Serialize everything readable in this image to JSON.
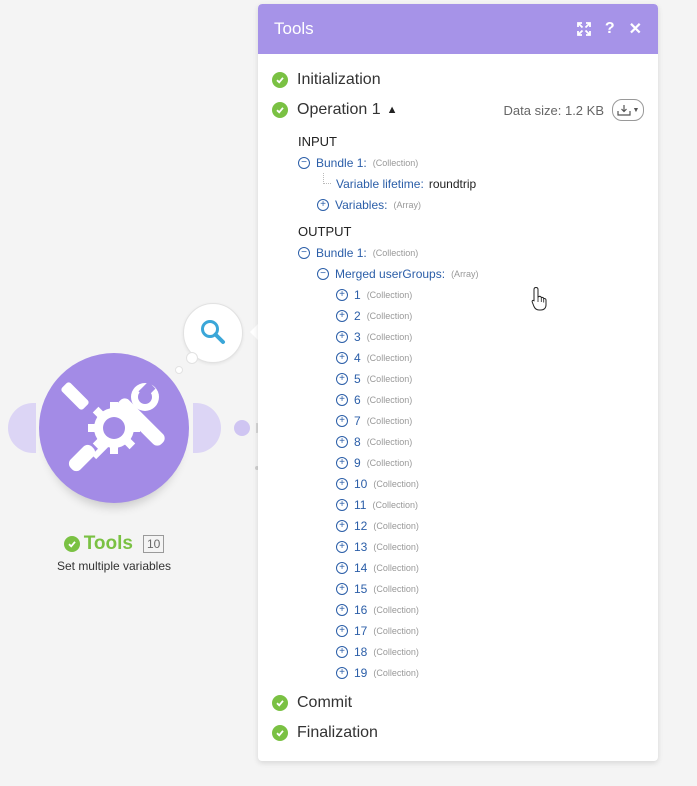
{
  "module": {
    "name": "Tools",
    "id": "10",
    "description": "Set multiple variables"
  },
  "panel": {
    "title": "Tools",
    "sections": {
      "initialization": "Initialization",
      "operation": "Operation 1",
      "commit": "Commit",
      "finalization": "Finalization"
    },
    "data_size": "Data size: 1.2 KB",
    "input": {
      "label": "INPUT",
      "bundle": {
        "name": "Bundle 1:",
        "type": "(Collection)"
      },
      "variable_lifetime": {
        "name": "Variable lifetime:",
        "value": "roundtrip"
      },
      "variables": {
        "name": "Variables:",
        "type": "(Array)"
      }
    },
    "output": {
      "label": "OUTPUT",
      "bundle": {
        "name": "Bundle 1:",
        "type": "(Collection)"
      },
      "merged": {
        "name": "Merged userGroups:",
        "type": "(Array)"
      },
      "items": [
        {
          "index": "1",
          "type": "(Collection)"
        },
        {
          "index": "2",
          "type": "(Collection)"
        },
        {
          "index": "3",
          "type": "(Collection)"
        },
        {
          "index": "4",
          "type": "(Collection)"
        },
        {
          "index": "5",
          "type": "(Collection)"
        },
        {
          "index": "6",
          "type": "(Collection)"
        },
        {
          "index": "7",
          "type": "(Collection)"
        },
        {
          "index": "8",
          "type": "(Collection)"
        },
        {
          "index": "9",
          "type": "(Collection)"
        },
        {
          "index": "10",
          "type": "(Collection)"
        },
        {
          "index": "11",
          "type": "(Collection)"
        },
        {
          "index": "12",
          "type": "(Collection)"
        },
        {
          "index": "13",
          "type": "(Collection)"
        },
        {
          "index": "14",
          "type": "(Collection)"
        },
        {
          "index": "15",
          "type": "(Collection)"
        },
        {
          "index": "16",
          "type": "(Collection)"
        },
        {
          "index": "17",
          "type": "(Collection)"
        },
        {
          "index": "18",
          "type": "(Collection)"
        },
        {
          "index": "19",
          "type": "(Collection)"
        }
      ]
    }
  },
  "colors": {
    "accent": "#a693e8",
    "module": "#a38be6",
    "success": "#7ac143",
    "link": "#2b5ea8"
  }
}
